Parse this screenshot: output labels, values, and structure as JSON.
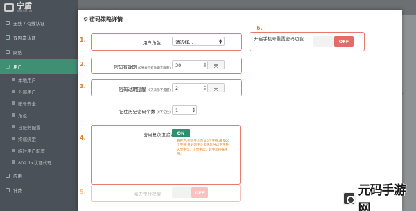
{
  "app": {
    "brand_name": "宁盾",
    "brand_sub": "NINGDUN"
  },
  "sidebar": {
    "items": [
      {
        "label": "无线 / 有线认证"
      },
      {
        "label": "双因素认证"
      },
      {
        "label": "网络"
      },
      {
        "label": "用户",
        "active": true
      },
      {
        "label": "本地用户",
        "sub": true
      },
      {
        "label": "外部用户",
        "sub": true
      },
      {
        "label": "账号安全",
        "sub": true
      },
      {
        "label": "角色",
        "sub": true
      },
      {
        "label": "自服务配置",
        "sub": true
      },
      {
        "label": "终端绑定",
        "sub": true
      },
      {
        "label": "临时用户配置",
        "sub": true
      },
      {
        "label": "802.1x认证代理",
        "sub": true
      },
      {
        "label": "应用"
      },
      {
        "label": "计费"
      }
    ]
  },
  "modal": {
    "title": "密码策略详情",
    "steps": [
      "1.",
      "2.",
      "3.",
      "4.",
      "5.",
      "6."
    ],
    "user_role": {
      "label": "用户角色",
      "value": "请选择..."
    },
    "validity": {
      "label": "密码有效期",
      "note": "(0天表示有效期无限制)",
      "value": "30",
      "unit": "天"
    },
    "expiry_reminder": {
      "label": "密码过期提醒",
      "note": "(0天表示不提醒)",
      "value": "2",
      "unit": "天"
    },
    "history": {
      "label": "记住历史密码个数",
      "note": "(0不记住)",
      "value": "1"
    },
    "complexity": {
      "label": "密码复杂度验证",
      "toggle": "ON",
      "hint": "看开启 密码至少包含6个字符,最多60个字符,且必须至少包含三种以下字符:大写字母、小写字母、数字和特殊字符。"
    },
    "daily_reminder": {
      "label": "每天定时提醒",
      "toggle": "OFF"
    },
    "reset_mobile": {
      "label": "开启手机号重置密码功能",
      "toggle": "OFF"
    }
  },
  "watermark": {
    "text": "元码手游网"
  },
  "colors": {
    "step": "#e07d20",
    "box_border": "#e57a6d",
    "toggle_on": "#2f8f6e",
    "toggle_off": "#e66a6a",
    "sidebar_active": "#3f8f75"
  }
}
